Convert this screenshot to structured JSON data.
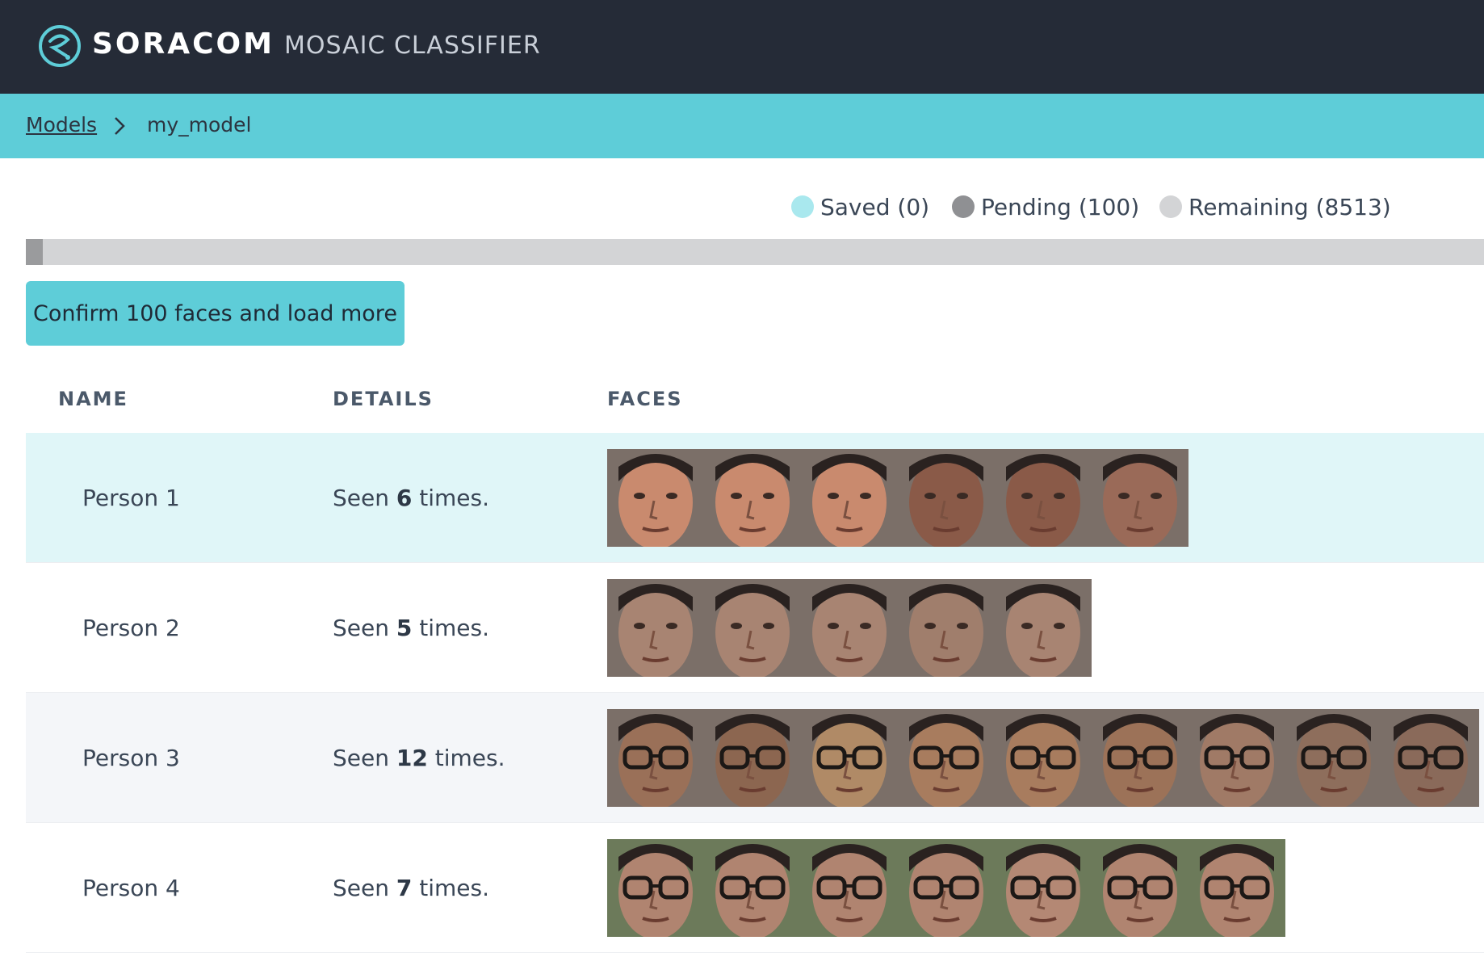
{
  "header": {
    "brand": "SORACOM",
    "app_title": "MOSAIC CLASSIFIER"
  },
  "breadcrumb": {
    "root": "Models",
    "current": "my_model"
  },
  "legend": [
    {
      "label": "Saved (0)",
      "color": "#a9e8ee"
    },
    {
      "label": "Pending (100)",
      "color": "#8f9093"
    },
    {
      "label": "Remaining (8513)",
      "color": "#d3d4d6"
    }
  ],
  "progress": {
    "pending_fraction": 0.0116
  },
  "confirm_button": "Confirm 100 faces and load more",
  "table": {
    "columns": [
      "NAME",
      "DETAILS",
      "FACES"
    ],
    "rows": [
      {
        "name": "Person 1",
        "details_pre": "Seen ",
        "count": "6",
        "details_post": " times.",
        "face_count": 6,
        "highlight": true,
        "palette": [
          "#c98a6e",
          "#c98a6e",
          "#c98a6e",
          "#8a5a48",
          "#8a5a48",
          "#9a6a58"
        ]
      },
      {
        "name": "Person 2",
        "details_pre": "Seen ",
        "count": "5",
        "details_post": " times.",
        "face_count": 5,
        "highlight": false,
        "palette": [
          "#a88472",
          "#a88472",
          "#a88472",
          "#a07e6c",
          "#a88472"
        ]
      },
      {
        "name": "Person 3",
        "details_pre": "Seen ",
        "count": "12",
        "details_post": " times.",
        "face_count": 9,
        "highlight": false,
        "palette": [
          "#9a7058",
          "#8c6650",
          "#b08a66",
          "#a87c5e",
          "#a87c5e",
          "#9c7258",
          "#a07a66",
          "#8e6e5c",
          "#8a6a5a"
        ]
      },
      {
        "name": "Person 4",
        "details_pre": "Seen ",
        "count": "7",
        "details_post": " times.",
        "face_count": 7,
        "highlight": false,
        "palette": [
          "#b08470",
          "#b08470",
          "#b08470",
          "#b08470",
          "#b48874",
          "#b08470",
          "#b08470"
        ]
      }
    ]
  },
  "colors": {
    "header_bg": "#252b37",
    "accent": "#5ecdd8",
    "highlight_row": "#e0f6f8",
    "alt_row": "#f4f6f9"
  }
}
